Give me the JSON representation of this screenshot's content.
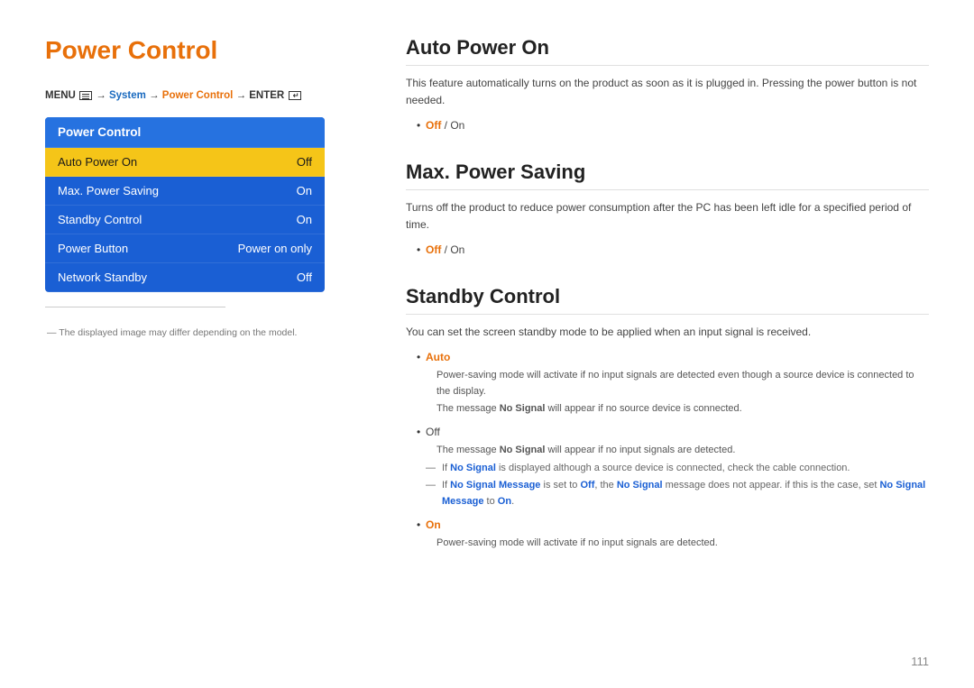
{
  "left": {
    "main_title": "Power Control",
    "menu_path": {
      "prefix": "MENU",
      "system": "System",
      "power_control": "Power Control",
      "enter": "ENTER"
    },
    "menu_box": {
      "title": "Power Control",
      "items": [
        {
          "label": "Auto Power On",
          "value": "Off",
          "active": true
        },
        {
          "label": "Max. Power Saving",
          "value": "On",
          "active": false
        },
        {
          "label": "Standby Control",
          "value": "On",
          "active": false
        },
        {
          "label": "Power Button",
          "value": "Power on only",
          "active": false
        },
        {
          "label": "Network Standby",
          "value": "Off",
          "active": false
        }
      ]
    },
    "disclaimer": "The displayed image may differ depending on the model."
  },
  "right": {
    "sections": [
      {
        "id": "auto-power-on",
        "title": "Auto Power On",
        "desc": "This feature automatically turns on the product as soon as it is plugged in. Pressing the power button is not needed.",
        "bullets": [
          {
            "text_plain": "Off / On",
            "off_orange": true
          }
        ]
      },
      {
        "id": "max-power-saving",
        "title": "Max. Power Saving",
        "desc": "Turns off the product to reduce power consumption after the PC has been left idle for a specified period of time.",
        "bullets": [
          {
            "text_plain": "Off / On",
            "off_orange": true
          }
        ]
      },
      {
        "id": "standby-control",
        "title": "Standby Control",
        "desc": "You can set the screen standby mode to be applied when an input signal is received.",
        "sub_bullets": [
          {
            "label": "Auto",
            "label_color": "orange",
            "notes": [
              "Power-saving mode will activate if no input signals are detected even though a source device is connected to the display.",
              "The message No Signal will appear if no source device is connected."
            ]
          },
          {
            "label": "Off",
            "label_color": "none",
            "notes": [
              "The message No Signal will appear if no input signals are detected."
            ],
            "dash_notes": [
              "If No Signal is displayed although a source device is connected, check the cable connection.",
              "If No Signal Message is set to Off, the No Signal message does not appear. if this is the case, set No Signal Message to On."
            ]
          },
          {
            "label": "On",
            "label_color": "orange",
            "notes": [
              "Power-saving mode will activate if no input signals are detected."
            ]
          }
        ]
      }
    ]
  },
  "page_number": "111"
}
